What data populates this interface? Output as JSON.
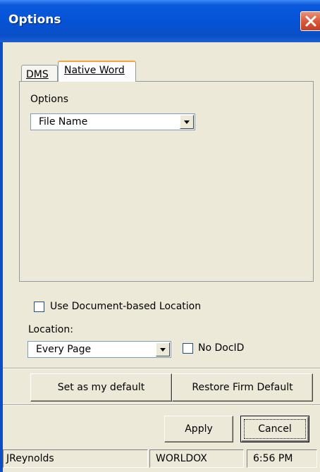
{
  "window": {
    "title": "Options"
  },
  "tabs": [
    {
      "label": "DMS",
      "active": false
    },
    {
      "label": "Native Word",
      "active": true
    }
  ],
  "options_panel": {
    "label": "Options",
    "selected": "File Name"
  },
  "use_doc_location": {
    "label": "Use Document-based Location",
    "checked": false
  },
  "location": {
    "label": "Location:",
    "selected": "Every Page"
  },
  "no_docid": {
    "label": "No DocID",
    "checked": false
  },
  "buttons": {
    "set_default": "Set as my default",
    "restore_default": "Restore Firm Default",
    "apply": "Apply",
    "cancel": "Cancel"
  },
  "statusbar": {
    "user": "JReynolds",
    "system": "WORLDOX",
    "time": "6:56 PM"
  },
  "colors": {
    "titlebar": "#0553d6",
    "close": "#d85a3c",
    "background": "#ece9d8"
  }
}
